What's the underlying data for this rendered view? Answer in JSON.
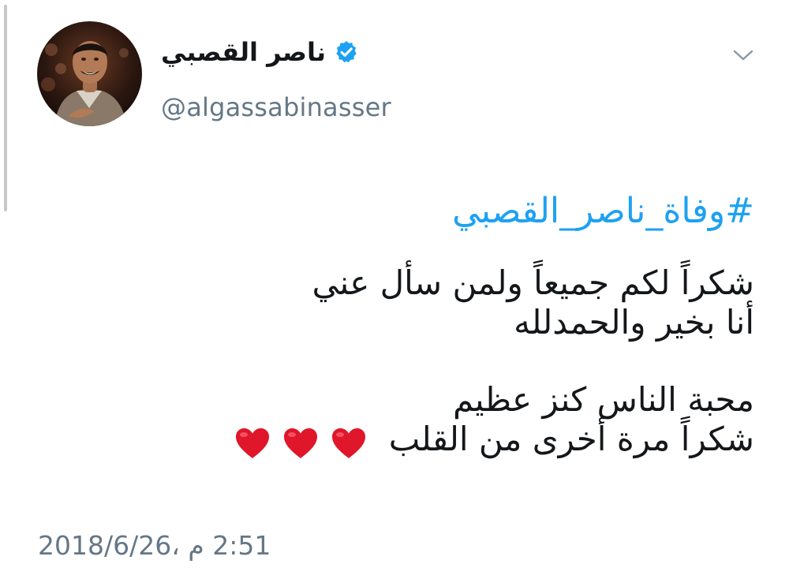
{
  "user": {
    "display_name": "ناصر القصبي",
    "handle": "@algassabinasser",
    "verified_icon": "verified-badge-icon",
    "avatar_icon": "profile-photo"
  },
  "menu": {
    "icon": "chevron-down-icon"
  },
  "tweet": {
    "hashtag": "#وفاة_ناصر_القصبي",
    "lines": [
      "شكراً  لكم جميعاً ولمن سأل عني",
      "أنا بخير والحمدلله",
      "محبة الناس كنز عظيم",
      "شكراً مرة أخرى من القلب"
    ],
    "emoji": [
      "❤️",
      "❤️",
      "❤️"
    ],
    "emoji_icon": "red-heart-icon"
  },
  "timestamp": "2:51 م ،2018/6/26",
  "colors": {
    "link": "#1da1f2",
    "secondary_text": "#657786",
    "primary_text": "#14171a",
    "verified": "#1da1f2",
    "heart": "#e0162b"
  }
}
